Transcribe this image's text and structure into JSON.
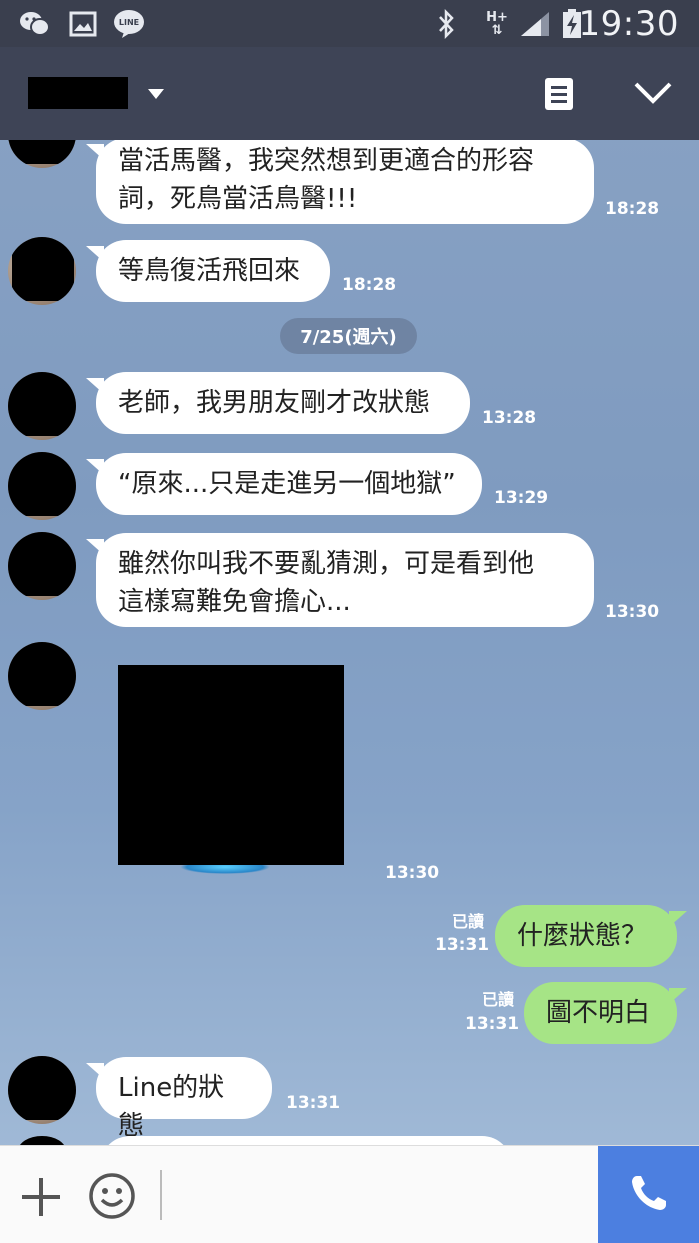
{
  "status_bar": {
    "time": "19:30",
    "icons": [
      "wechat-icon",
      "gallery-icon",
      "line-icon",
      "bluetooth-icon",
      "hplus-network-icon",
      "signal-icon",
      "battery-charging-icon"
    ],
    "network_label": "H+",
    "line_badge": "LINE"
  },
  "header": {
    "contact_name": "",
    "menu_icon": "note-icon",
    "collapse_icon": "chevron-down-icon"
  },
  "chat": {
    "date_separator": "7/25(週六)",
    "messages": [
      {
        "side": "in",
        "text": "當活馬醫，我突然想到更適合的形容\n詞，死鳥當活鳥醫!!!",
        "time": "18:28"
      },
      {
        "side": "in",
        "text": "等鳥復活飛回來",
        "time": "18:28"
      },
      {
        "side": "in",
        "text": "老師，我男朋友剛才改狀態",
        "time": "13:28"
      },
      {
        "side": "in",
        "text": "“原來...只是走進另一個地獄”",
        "time": "13:29"
      },
      {
        "side": "in",
        "text": "雖然你叫我不要亂猜測，可是看到他\n這樣寫難免會擔心...",
        "time": "13:30"
      },
      {
        "side": "in",
        "type": "image",
        "time": "13:30"
      },
      {
        "side": "out",
        "text": "什麼狀態？",
        "time": "13:31",
        "read": "已讀"
      },
      {
        "side": "out",
        "text": "圖不明白",
        "time": "13:31",
        "read": "已讀"
      },
      {
        "side": "in",
        "text": "Line的狀態",
        "time": "13:31"
      }
    ]
  },
  "input_bar": {
    "add_icon": "plus-icon",
    "sticker_icon": "smiley-icon",
    "call_icon": "phone-icon"
  },
  "colors": {
    "status_bar": "#3a3f4e",
    "header": "#3e4456",
    "incoming_bubble": "#ffffff",
    "outgoing_bubble": "#a6e486",
    "call_button": "#4c7fe0"
  }
}
